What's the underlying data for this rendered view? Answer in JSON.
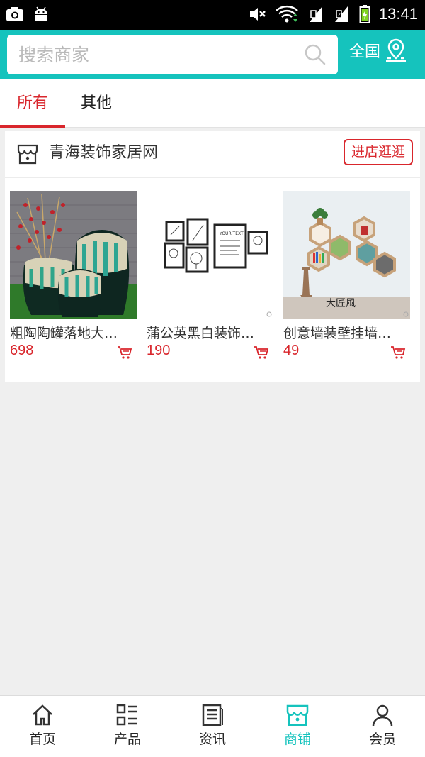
{
  "status_bar": {
    "time": "13:41"
  },
  "header": {
    "search_placeholder": "搜索商家",
    "region_label": "全国",
    "accent": "#15c3bd"
  },
  "tabs": [
    {
      "label": "所有",
      "active": true
    },
    {
      "label": "其他",
      "active": false
    }
  ],
  "shop": {
    "name": "青海装饰家居网",
    "visit_label": "进店逛逛",
    "products": [
      {
        "name": "粗陶陶罐落地大…",
        "price": "698"
      },
      {
        "name": "蒲公英黑白装饰…",
        "price": "190"
      },
      {
        "name": "创意墙装壁挂墙…",
        "price": "49"
      }
    ]
  },
  "bottom_nav": [
    {
      "label": "首页",
      "icon": "home-icon",
      "active": false
    },
    {
      "label": "产品",
      "icon": "list-icon",
      "active": false
    },
    {
      "label": "资讯",
      "icon": "news-icon",
      "active": false
    },
    {
      "label": "商铺",
      "icon": "shop-icon",
      "active": true
    },
    {
      "label": "会员",
      "icon": "user-icon",
      "active": false
    }
  ],
  "colors": {
    "price": "#d9262c",
    "active_tab": "#d9262c"
  }
}
